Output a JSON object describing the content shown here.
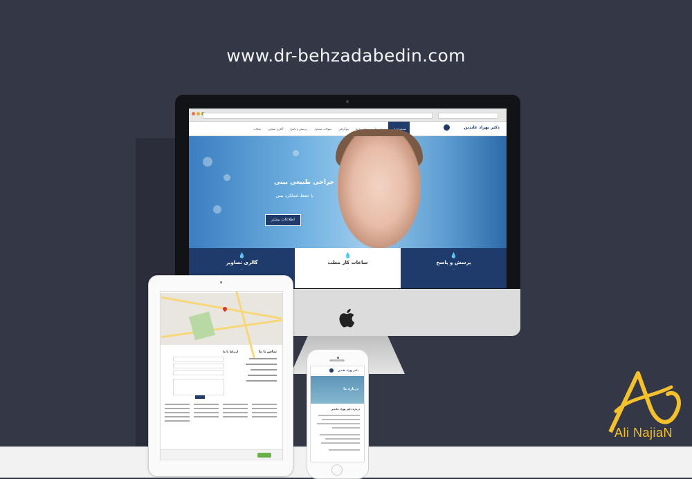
{
  "headline": "www.dr-behzadabedin.com",
  "site": {
    "logo_text": "دکتر بهزاد عابدین",
    "nav_items": [
      "صفحه اصلی",
      "درباره ما",
      "تماس با ما",
      "بیوگرافی",
      "سوالات متداول",
      "پرسش و پاسخ",
      "گالری تصاویر",
      "مقالات"
    ],
    "hero": {
      "title": "جراحی طبیعی بینی",
      "subtitle": "با حفظ عملکرد بینی",
      "button": "اطلاعات بیشتر"
    },
    "features": [
      {
        "icon": "drop-icon",
        "title": "گالری تصاویر",
        "text": "...",
        "style": "dark"
      },
      {
        "icon": "drop-icon",
        "title": "ساعات کار مطب",
        "text": "...",
        "style": "light"
      },
      {
        "icon": "drop-icon",
        "title": "پرسش و پاسخ",
        "text": "...",
        "style": "dark"
      }
    ]
  },
  "tablet": {
    "contact_title": "تماس با ما",
    "form_title": "ارتباط با ما"
  },
  "phone": {
    "logo_text": "دکتر بهزاد عابدین",
    "hero_title": "درباره ما",
    "heading": "درباره دکتر بهزاد عابدین"
  },
  "watermark": {
    "text": "Ali NajiaN"
  },
  "colors": {
    "background": "#343846",
    "brand_navy": "#1e3b6b",
    "logo_gold": "#f4c12c"
  }
}
